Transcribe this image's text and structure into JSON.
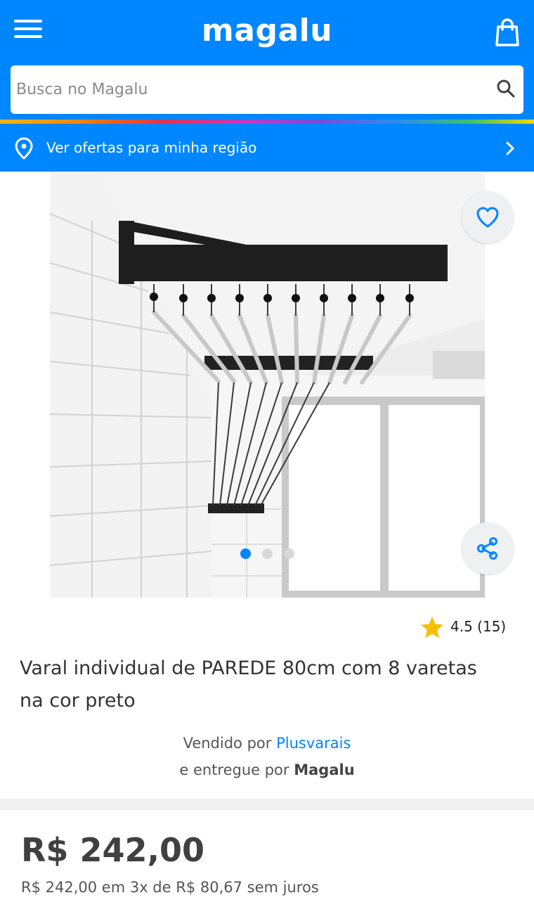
{
  "header": {
    "logo_text": "magalu",
    "menu_icon": "hamburger-menu-icon",
    "bag_icon": "shopping-bag-icon"
  },
  "search": {
    "placeholder": "Busca no Magalu",
    "value": "",
    "icon": "search-icon"
  },
  "region_bar": {
    "label": "Ver ofertas para minha região",
    "icon": "location-pin-icon",
    "chevron_icon": "chevron-right-icon"
  },
  "gallery": {
    "image_count": 3,
    "active_index": 0,
    "favorite_icon": "heart-icon",
    "share_icon": "share-icon"
  },
  "product": {
    "rating_value": "4.5",
    "rating_count": "(15)",
    "rating_text": "4.5 (15)",
    "title": "Varal individual de PAREDE 80cm com 8 varetas na cor preto",
    "sold_by_prefix": "Vendido por",
    "seller_name": "Plusvarais",
    "delivered_by_prefix": "e entregue por",
    "delivery_name": "Magalu",
    "price": "R$ 242,00",
    "installments": "R$ 242,00 em 3x de R$ 80,67 sem juros"
  },
  "colors": {
    "brand_blue": "#0086ff",
    "star_yellow": "#f5c000",
    "active_dot": "#0086ff",
    "inactive_dot": "#d8d8d8"
  }
}
